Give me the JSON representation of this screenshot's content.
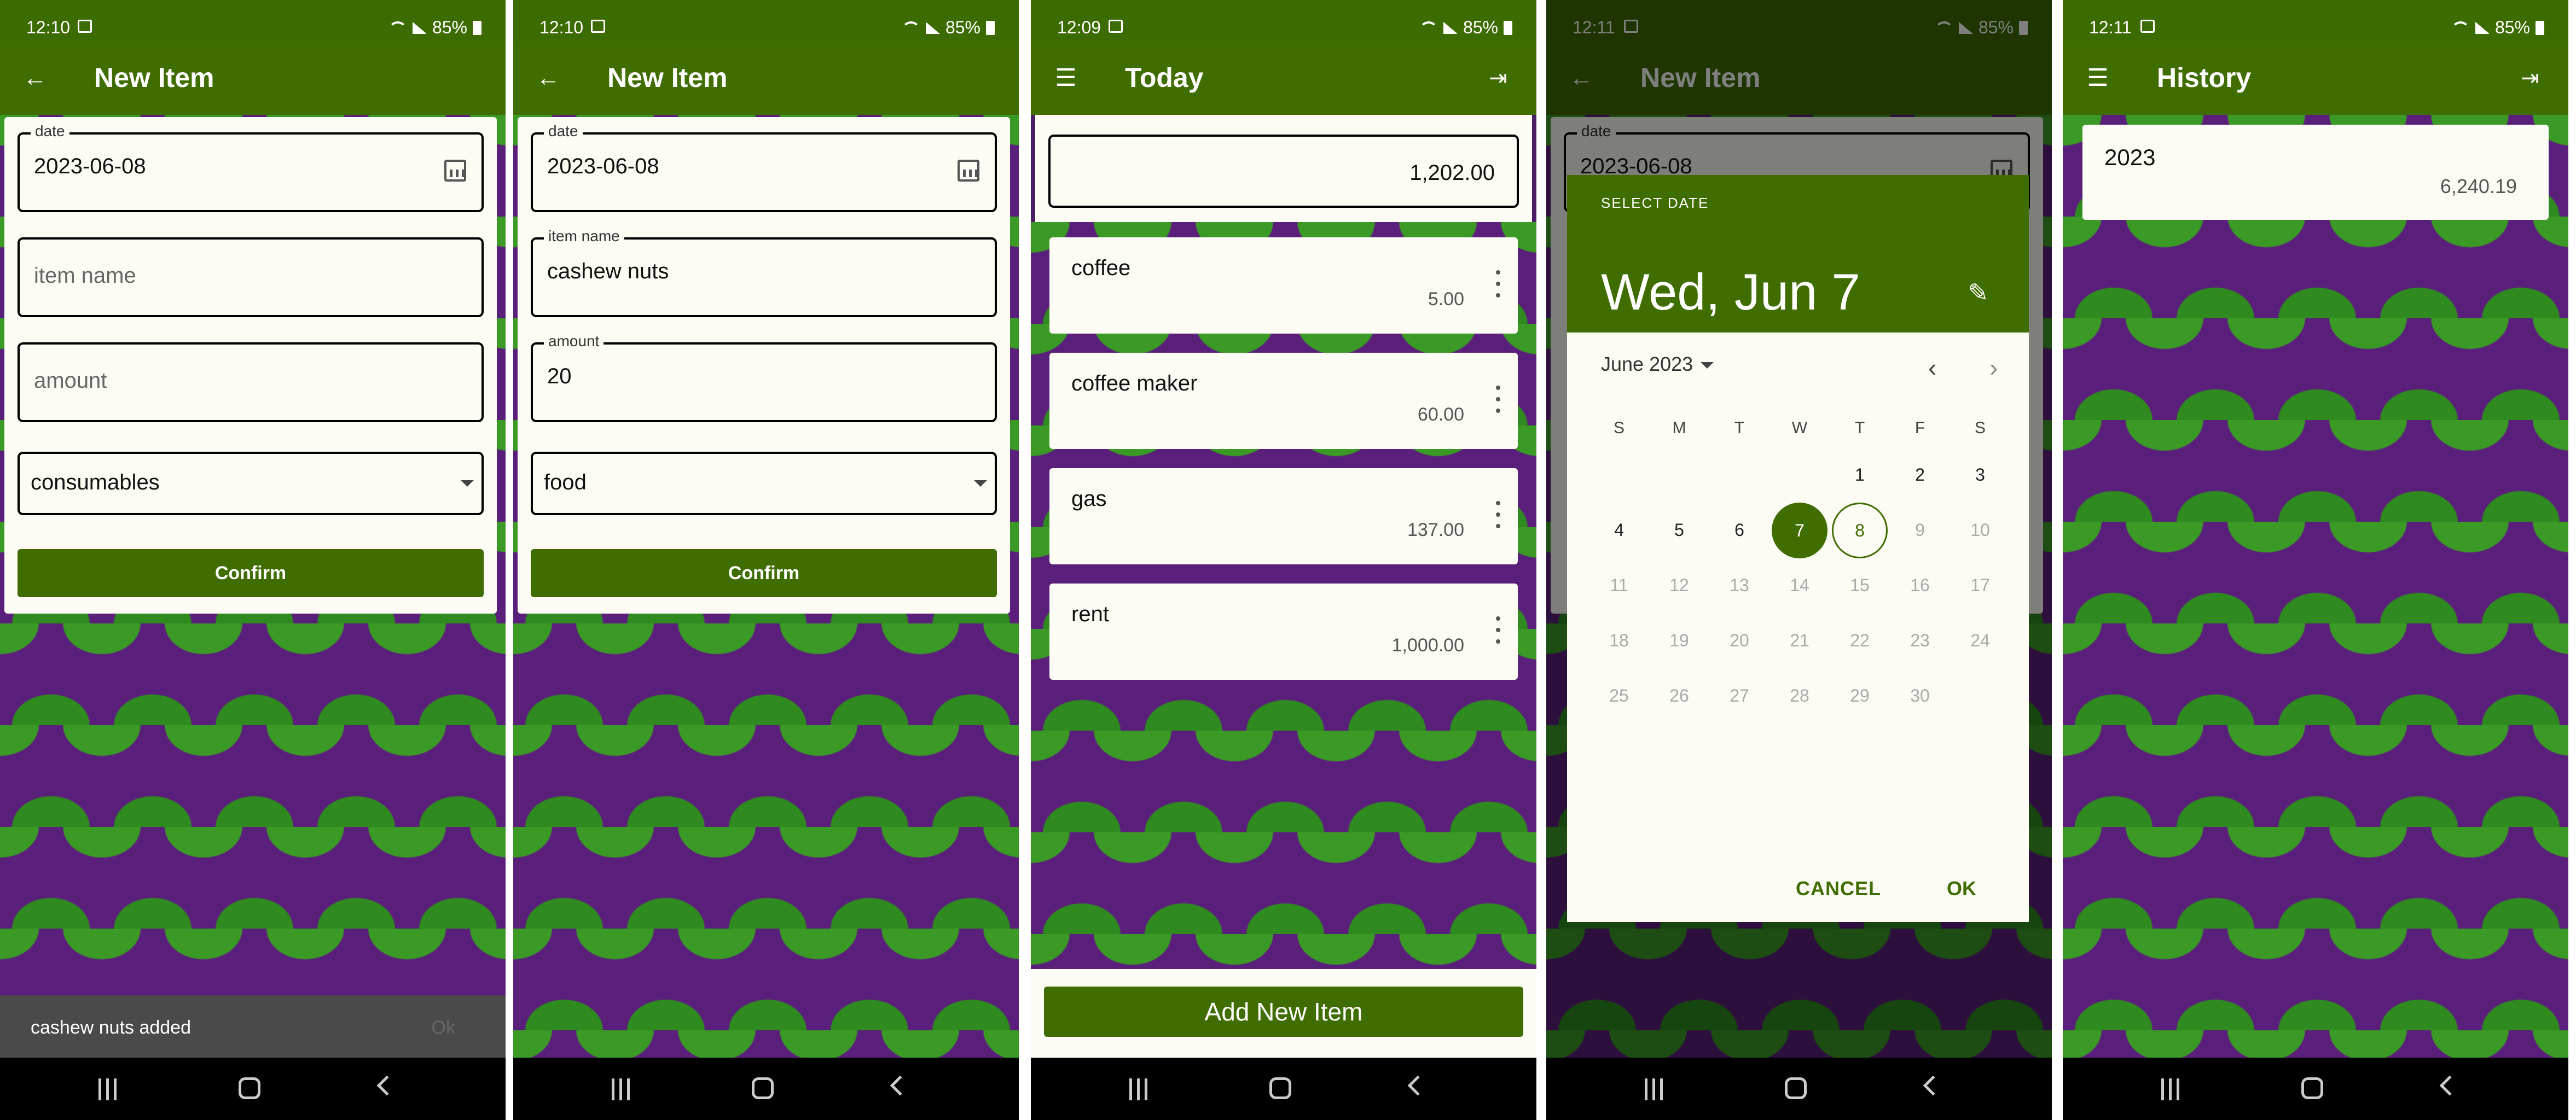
{
  "screens": [
    {
      "status": {
        "time": "12:10",
        "battery": "85%"
      },
      "title": "New Item",
      "date_label": "date",
      "date_value": "2023-06-08",
      "item_placeholder": "item name",
      "amount_placeholder": "amount",
      "category": "consumables",
      "confirm": "Confirm",
      "snackbar": {
        "message": "cashew nuts added",
        "action": "Ok"
      }
    },
    {
      "status": {
        "time": "12:10",
        "battery": "85%"
      },
      "title": "New Item",
      "date_label": "date",
      "date_value": "2023-06-08",
      "item_label": "item name",
      "item_value": "cashew nuts",
      "amount_label": "amount",
      "amount_value": "20",
      "category": "food",
      "confirm": "Confirm"
    },
    {
      "status": {
        "time": "12:09",
        "battery": "85%"
      },
      "title": "Today",
      "total": "1,202.00",
      "items": [
        {
          "name": "coffee",
          "amount": "5.00"
        },
        {
          "name": "coffee maker",
          "amount": "60.00"
        },
        {
          "name": "gas",
          "amount": "137.00"
        },
        {
          "name": "rent",
          "amount": "1,000.00"
        }
      ],
      "add_button": "Add New Item"
    },
    {
      "status": {
        "time": "12:11",
        "battery": "85%"
      },
      "title": "New Item",
      "date_label": "date",
      "date_value": "2023-06-08",
      "dialog": {
        "header_small": "SELECT DATE",
        "header_big": "Wed, Jun 7",
        "month": "June 2023",
        "weekdays": [
          "S",
          "M",
          "T",
          "W",
          "T",
          "F",
          "S"
        ],
        "selected_day": "7",
        "today_day": "8",
        "cancel": "CANCEL",
        "ok": "OK"
      }
    },
    {
      "status": {
        "time": "12:11",
        "battery": "85%"
      },
      "title": "History",
      "year": "2023",
      "total": "6,240.19"
    }
  ],
  "colors": {
    "primary": "#3f6d00",
    "card": "#fcfcf4",
    "pattern_purple": "#5a1f7a",
    "pattern_green": "#3a9a25"
  },
  "icons": [
    "back-arrow-icon",
    "menu-icon",
    "logout-icon",
    "calendar-icon",
    "dropdown-caret-icon",
    "more-vert-icon",
    "edit-icon",
    "chevron-left-icon",
    "chevron-right-icon"
  ]
}
